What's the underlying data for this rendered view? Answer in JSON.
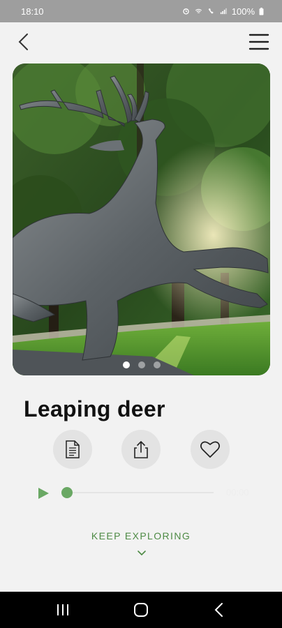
{
  "status_bar": {
    "time": "18:10",
    "battery": "100%",
    "icons": [
      "alarm-icon",
      "wifi-icon",
      "volte-icon",
      "signal-icon",
      "battery-icon"
    ]
  },
  "header": {
    "back_icon": "chevron-left-icon",
    "menu_icon": "hamburger-menu-icon"
  },
  "hero": {
    "image": "statue-of-leaping-deer-photo",
    "slide_count": 3,
    "active_slide": 1
  },
  "title": "Leaping deer",
  "actions": [
    {
      "name": "description",
      "icon": "document-icon"
    },
    {
      "name": "share",
      "icon": "share-icon"
    },
    {
      "name": "favorite",
      "icon": "heart-icon"
    }
  ],
  "player": {
    "play_icon": "play-icon",
    "progress": 0.0,
    "duration": "00:00"
  },
  "keep_exploring": {
    "label": "KEEP EXPLORING",
    "icon": "chevron-down-icon"
  },
  "colors": {
    "accent": "#6aa864",
    "link": "#4d8a44",
    "status_bar": "#9e9e9e",
    "background": "#f2f2f2"
  },
  "nav_bar": {
    "buttons": [
      "recent-apps-icon",
      "home-icon",
      "back-icon"
    ]
  }
}
